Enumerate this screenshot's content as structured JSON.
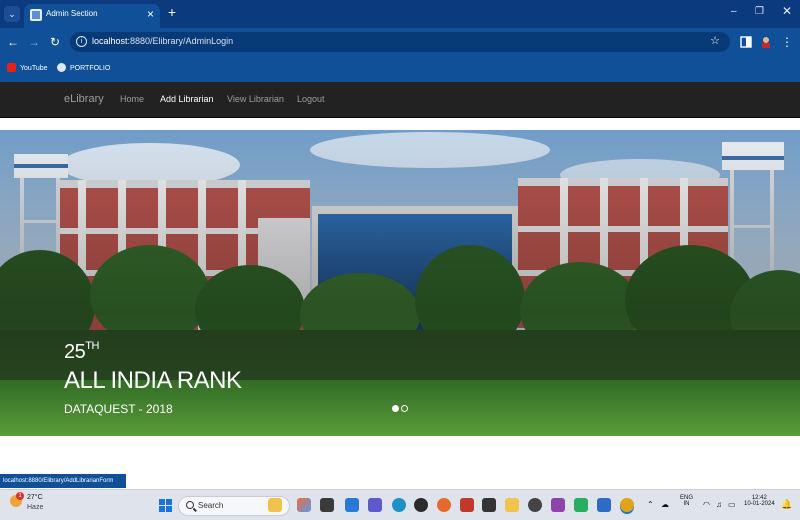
{
  "browser": {
    "tab_title": "Admin Section",
    "tab_close": "×",
    "new_tab": "+",
    "url_host": "localhost",
    "url_rest": ":8880/Elibrary/AdminLogin",
    "bookmarks": [
      {
        "label": "YouTube"
      },
      {
        "label": "PORTFOLIO"
      }
    ],
    "status_url": "localhost:8880/Elibrary/AddLibrarianForm"
  },
  "navbar": {
    "brand": "eLibrary",
    "links": [
      {
        "label": "Home",
        "active": false
      },
      {
        "label": "Add Librarian",
        "active": true
      },
      {
        "label": "View Librarian",
        "active": false
      },
      {
        "label": "Logout",
        "active": false
      }
    ],
    "background": "#222222"
  },
  "hero": {
    "rank_number": "25",
    "rank_suffix": "TH",
    "headline": "ALL INDIA RANK",
    "subline": "DATAQUEST - 2018",
    "slide_count": 2,
    "active_slide": 1
  },
  "taskbar": {
    "weather_temp": "27°C",
    "weather_cond": "Haze",
    "weather_badge": "1",
    "search_placeholder": "Search",
    "language_top": "ENG",
    "language_bottom": "IN",
    "time": "12:42",
    "date": "10-01-2024"
  },
  "colors": {
    "chrome_dark": "#0b3a7e",
    "chrome": "#0f5099",
    "accent_blue": "#1a73d9"
  }
}
